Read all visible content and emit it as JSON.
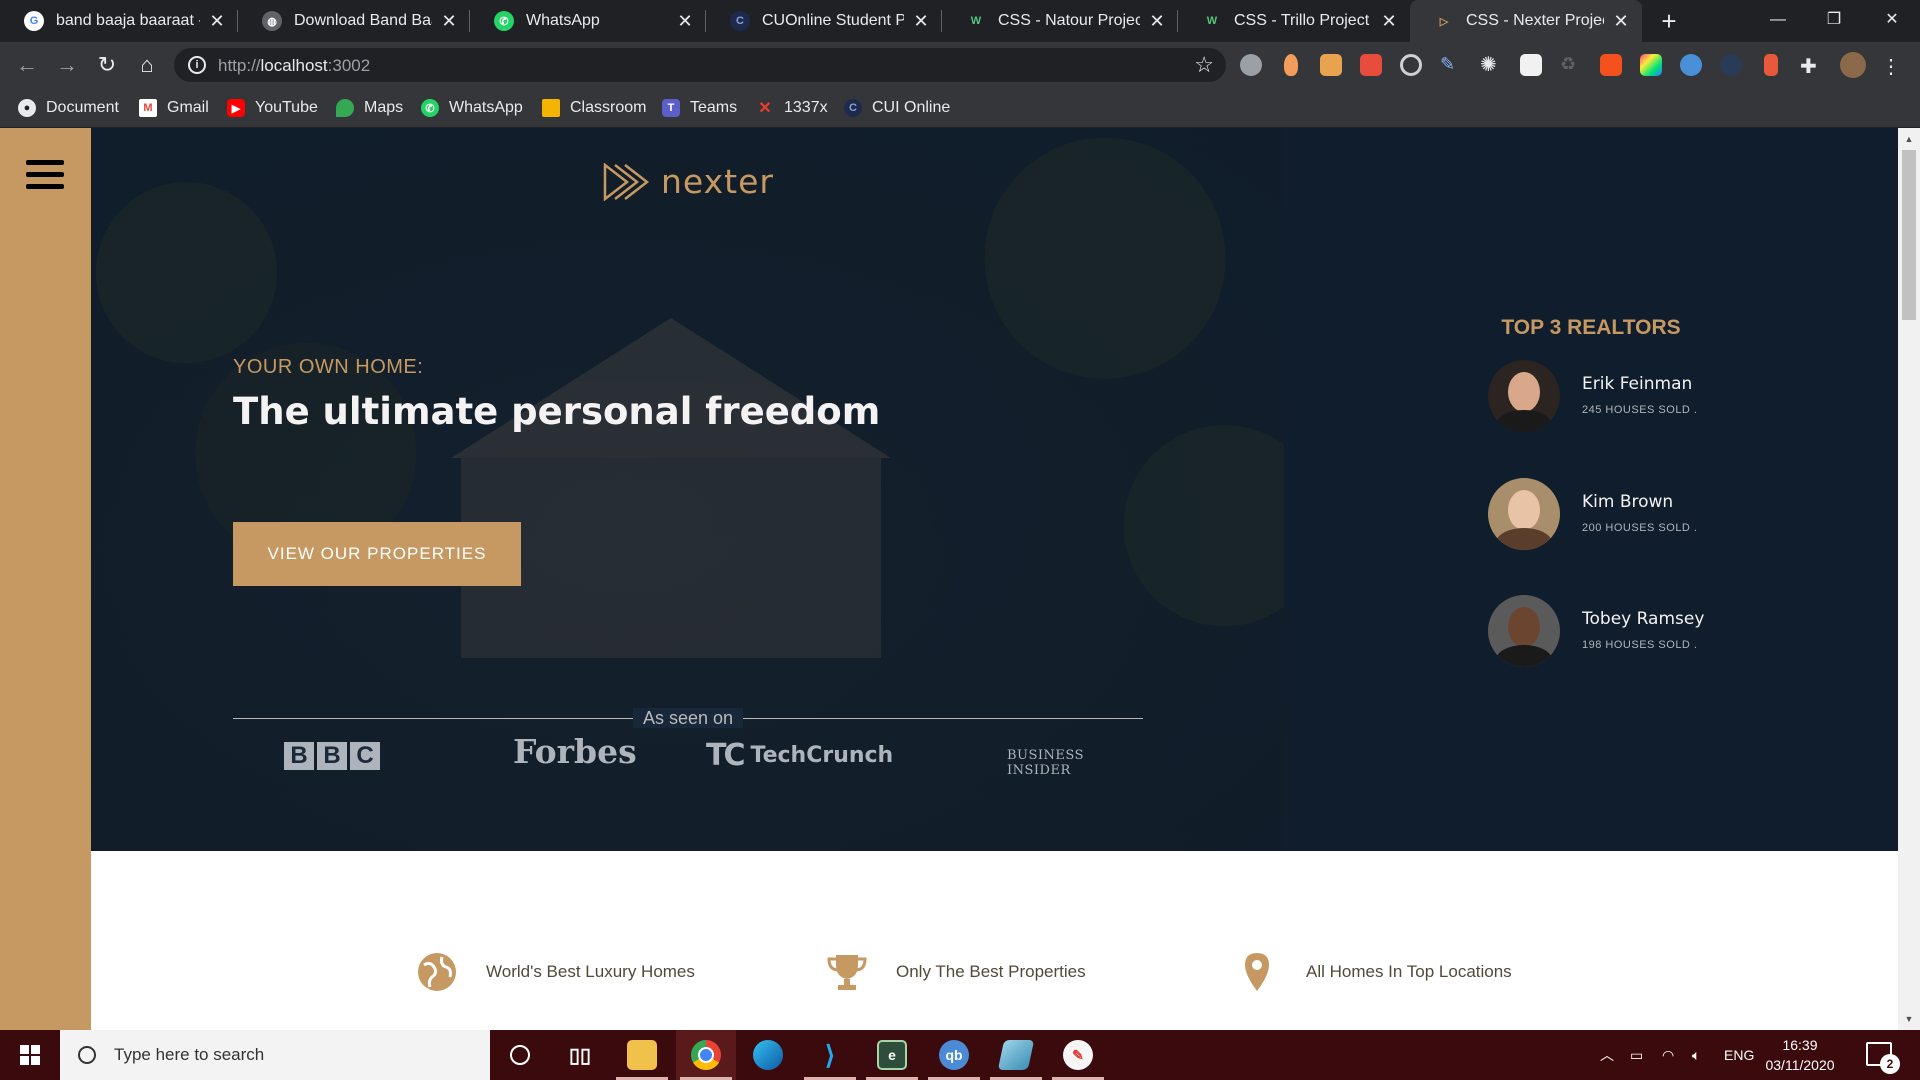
{
  "browser": {
    "tabs": [
      {
        "title": "band baaja baaraat - G",
        "icon": "google-icon"
      },
      {
        "title": "Download Band Baaja B",
        "icon": "globe-icon"
      },
      {
        "title": "WhatsApp",
        "icon": "whatsapp-icon"
      },
      {
        "title": "CUOnline Student Port",
        "icon": "cui-icon"
      },
      {
        "title": "CSS - Natour Project",
        "icon": "natours-icon"
      },
      {
        "title": "CSS - Trillo Project",
        "icon": "trillo-icon"
      },
      {
        "title": "CSS - Nexter Project",
        "icon": "nexter-icon",
        "active": true
      }
    ],
    "new_tab_glyph": "+",
    "address": {
      "scheme": "http://",
      "host": "localhost",
      "port": ":3002"
    },
    "bookmarks": [
      {
        "label": "Document",
        "icon": "github-icon"
      },
      {
        "label": "Gmail",
        "icon": "gmail-icon"
      },
      {
        "label": "YouTube",
        "icon": "youtube-icon"
      },
      {
        "label": "Maps",
        "icon": "maps-icon"
      },
      {
        "label": "WhatsApp",
        "icon": "whatsapp-icon"
      },
      {
        "label": "Classroom",
        "icon": "classroom-icon"
      },
      {
        "label": "Teams",
        "icon": "teams-icon"
      },
      {
        "label": "1337x",
        "icon": "x-icon"
      },
      {
        "label": "CUI Online",
        "icon": "cui-icon"
      }
    ]
  },
  "page": {
    "logo_text": "nexter",
    "subtitle": "YOUR OWN HOME:",
    "headline": "The ultimate personal freedom",
    "cta_label": "VIEW OUR PROPERTIES",
    "seen_on_label": "As seen on",
    "press": {
      "bbc": [
        "B",
        "B",
        "C"
      ],
      "forbes": "Forbes",
      "techcrunch": "TechCrunch",
      "business_insider": [
        "BUSINESS",
        "INSIDER"
      ]
    },
    "realtors": {
      "title": "TOP 3 REALTORS",
      "items": [
        {
          "name": "Erik Feinman",
          "sold": "245 HOUSES SOLD ."
        },
        {
          "name": "Kim Brown",
          "sold": "200 HOUSES SOLD ."
        },
        {
          "name": "Tobey Ramsey",
          "sold": "198 HOUSES SOLD ."
        }
      ]
    },
    "features": [
      {
        "label": "World's Best Luxury Homes",
        "icon": "globe-icon"
      },
      {
        "label": "Only The Best Properties",
        "icon": "trophy-icon"
      },
      {
        "label": "All Homes In Top Locations",
        "icon": "map-pin-icon"
      }
    ],
    "colors": {
      "primary": "#c69963",
      "dark": "#101d2c",
      "light": "#f4f2f2"
    }
  },
  "taskbar": {
    "search_placeholder": "Type here to search",
    "language": "ENG",
    "time": "16:39",
    "date": "03/11/2020",
    "notification_count": "2"
  }
}
